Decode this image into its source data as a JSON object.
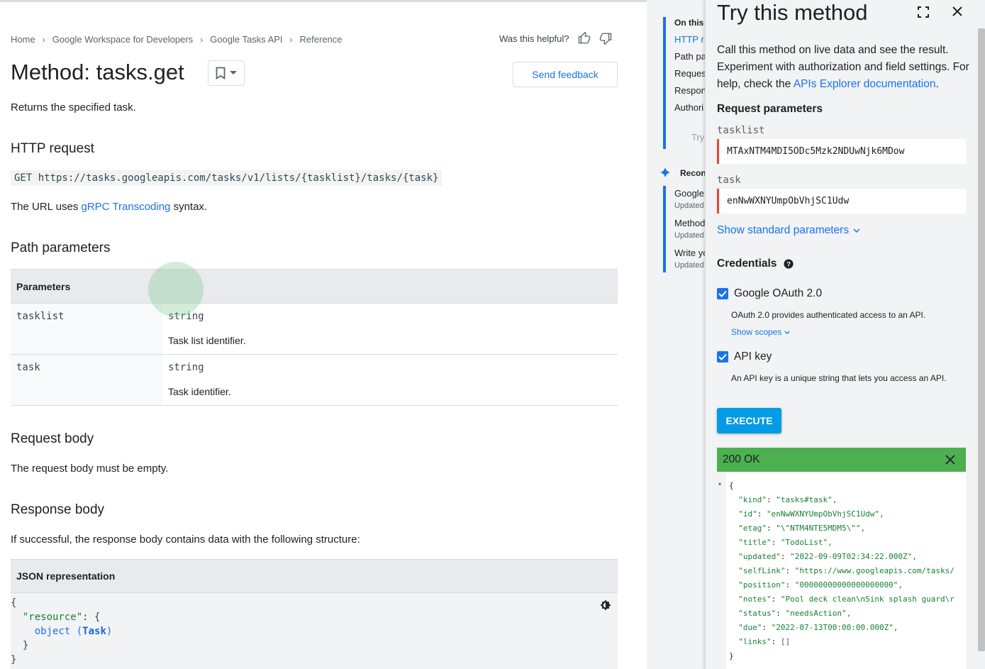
{
  "breadcrumb": [
    "Home",
    "Google Workspace for Developers",
    "Google Tasks API",
    "Reference"
  ],
  "helpful_text": "Was this helpful?",
  "page_title": "Method: tasks.get",
  "send_feedback": "Send feedback",
  "summary": "Returns the specified task.",
  "http_request": {
    "heading": "HTTP request",
    "code": "GET https://tasks.googleapis.com/tasks/v1/lists/{tasklist}/tasks/{task}",
    "note_prefix": "The URL uses ",
    "note_link": "gRPC Transcoding",
    "note_suffix": " syntax."
  },
  "path_parameters": {
    "heading": "Path parameters",
    "column_header": "Parameters",
    "rows": [
      {
        "name": "tasklist",
        "type": "string",
        "desc": "Task list identifier."
      },
      {
        "name": "task",
        "type": "string",
        "desc": "Task identifier."
      }
    ]
  },
  "request_body": {
    "heading": "Request body",
    "text": "The request body must be empty."
  },
  "response_body": {
    "heading": "Response body",
    "text": "If successful, the response body contains data with the following structure:",
    "json_header": "JSON representation",
    "json_lines": {
      "open": "{",
      "key": "\"resource\"",
      "colon": ": {",
      "kw": "object",
      "type_open": " (",
      "type": "Task",
      "type_close": ")",
      "inner_close": "}",
      "close": "}"
    }
  },
  "toc": {
    "heading": "On this",
    "items": [
      "HTTP r",
      "Path pa",
      "Reques",
      "Respon",
      "Authori"
    ],
    "try_item": "Try",
    "recommended": "Recon",
    "rec_items": [
      {
        "title": "Google",
        "sub": "Updated"
      },
      {
        "title": "Method",
        "sub": "Updated"
      },
      {
        "title": "Write yo",
        "sub": "Updated"
      }
    ]
  },
  "try_panel": {
    "title": "Try this method",
    "desc_prefix": "Call this method on live data and see the result. Experiment with authorization and field settings. For help, check the ",
    "desc_link": "APIs Explorer documentation",
    "desc_suffix": ".",
    "request_params_heading": "Request parameters",
    "fields": [
      {
        "label": "tasklist",
        "value": "MTAxNTM4MDI5ODc5Mzk2NDUwNjk6MDow"
      },
      {
        "label": "task",
        "value": "enNwWXNYUmpObVhjSC1Udw"
      }
    ],
    "show_standard_params": "Show standard parameters",
    "credentials_heading": "Credentials",
    "oauth": {
      "label": "Google OAuth 2.0",
      "desc": "OAuth 2.0 provides authenticated access to an API.",
      "scopes": "Show scopes",
      "checked": true
    },
    "apikey": {
      "label": "API key",
      "desc": "An API key is a unique string that lets you access an API.",
      "checked": true
    },
    "execute": "EXECUTE",
    "status": "200 OK",
    "response": [
      {
        "k": "",
        "v": "{"
      },
      {
        "k": "\"kind\"",
        "v": "\"tasks#task\","
      },
      {
        "k": "\"id\"",
        "v": "\"enNwWXNYUmpObVhjSC1Udw\","
      },
      {
        "k": "\"etag\"",
        "v": "\"\\\"NTM4NTE5MDM5\\\"\","
      },
      {
        "k": "\"title\"",
        "v": "\"TodoList\","
      },
      {
        "k": "\"updated\"",
        "v": "\"2022-09-09T02:34:22.000Z\","
      },
      {
        "k": "\"selfLink\"",
        "v": "\"https://www.googleapis.com/tasks/"
      },
      {
        "k": "\"position\"",
        "v": "\"00000000000000000000\","
      },
      {
        "k": "\"notes\"",
        "v": "\"Pool deck clean\\nSink splash guard\\r"
      },
      {
        "k": "\"status\"",
        "v": "\"needsAction\","
      },
      {
        "k": "\"due\"",
        "v": "\"2022-07-13T00:00:00.000Z\","
      },
      {
        "k": "\"links\"",
        "v": "[]"
      },
      {
        "k": "",
        "v": "}"
      }
    ]
  },
  "colors": {
    "accent": "#1a73e8",
    "success": "#4caf50",
    "execute": "#039be5",
    "required": "#ea4335"
  }
}
